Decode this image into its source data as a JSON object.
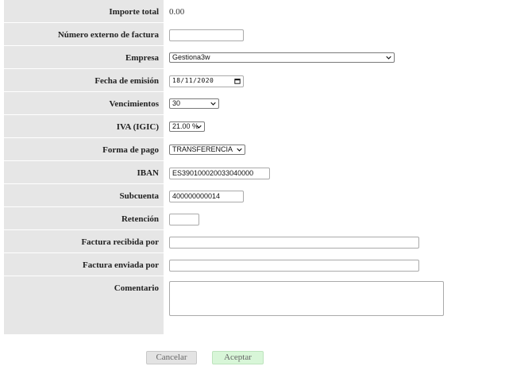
{
  "form": {
    "importe_total": {
      "label": "Importe total",
      "value": "0.00"
    },
    "numero_externo": {
      "label": "Número externo de factura",
      "value": ""
    },
    "empresa": {
      "label": "Empresa",
      "value": "Gestiona3w"
    },
    "fecha_emision": {
      "label": "Fecha de emisión",
      "value": "18/11/2020"
    },
    "vencimientos": {
      "label": "Vencimientos",
      "value": "30"
    },
    "iva": {
      "label": "IVA (IGIC)",
      "value": "21.00 %"
    },
    "forma_pago": {
      "label": "Forma de pago",
      "value": "TRANSFERENCIA"
    },
    "iban": {
      "label": "IBAN",
      "value": "ES390100020033040000"
    },
    "subcuenta": {
      "label": "Subcuenta",
      "value": "400000000014"
    },
    "retencion": {
      "label": "Retención",
      "value": ""
    },
    "recibida_por": {
      "label": "Factura recibida por",
      "value": ""
    },
    "enviada_por": {
      "label": "Factura enviada por",
      "value": ""
    },
    "comentario": {
      "label": "Comentario",
      "value": ""
    }
  },
  "buttons": {
    "cancel": "Cancelar",
    "accept": "Aceptar"
  },
  "icons": {
    "select": "chevron-down-icon",
    "date": "calendar-icon"
  },
  "colors": {
    "label_bg": "#e6e6e6",
    "accept_bg": "#d8f6d8",
    "cancel_bg": "#e3e3e3"
  }
}
